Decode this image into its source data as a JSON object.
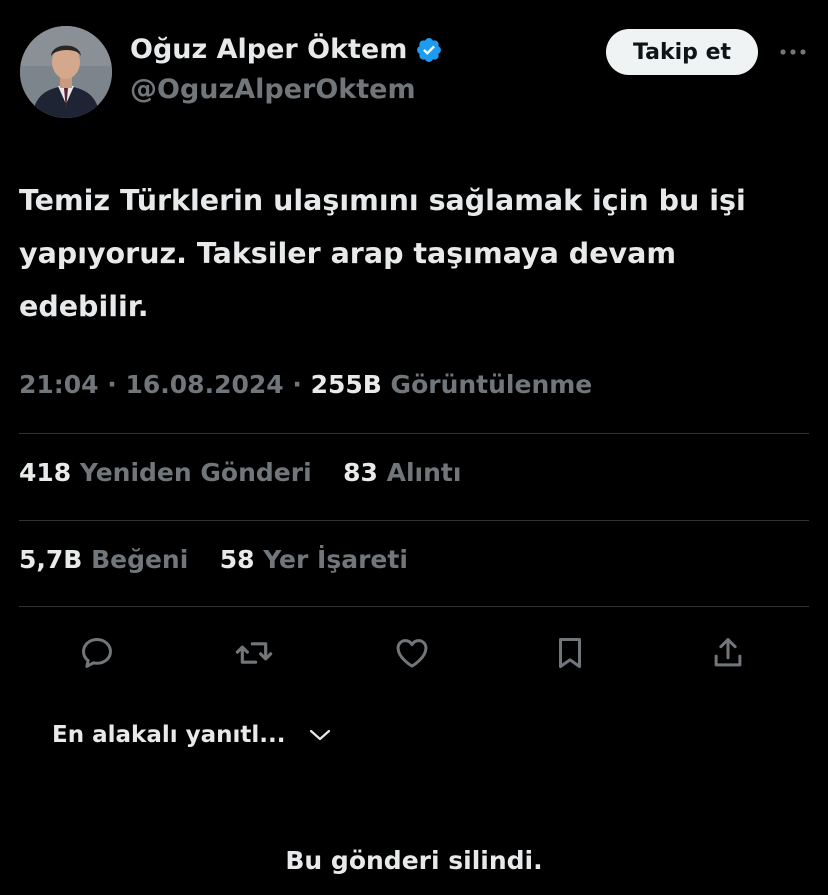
{
  "author": {
    "name": "Oğuz Alper Öktem",
    "handle": "@OguzAlperOktem",
    "verified": true
  },
  "follow_label": "Takip et",
  "tweet": {
    "line1": "Temiz Türklerin ulaşımını sağlamak için bu işi",
    "line2": "yapıyoruz. Taksiler arap taşımaya devam",
    "line3": "edebilir."
  },
  "meta": {
    "time": "21:04",
    "date": "16.08.2024",
    "views_count": "255B",
    "views_label": "Görüntülenme"
  },
  "stats": {
    "reposts_count": "418",
    "reposts_label": "Yeniden Gönderi",
    "quotes_count": "83",
    "quotes_label": "Alıntı",
    "likes_count": "5,7B",
    "likes_label": "Beğeni",
    "bookmarks_count": "58",
    "bookmarks_label": "Yer İşareti"
  },
  "sort_label": "En alakalı yanıtl...",
  "deleted_notice": "Bu gönderi silindi.",
  "colors": {
    "background": "#000000",
    "text": "#e7e9ea",
    "muted": "#71767b",
    "divider": "#2f3336",
    "verified": "#1d9bf0"
  }
}
